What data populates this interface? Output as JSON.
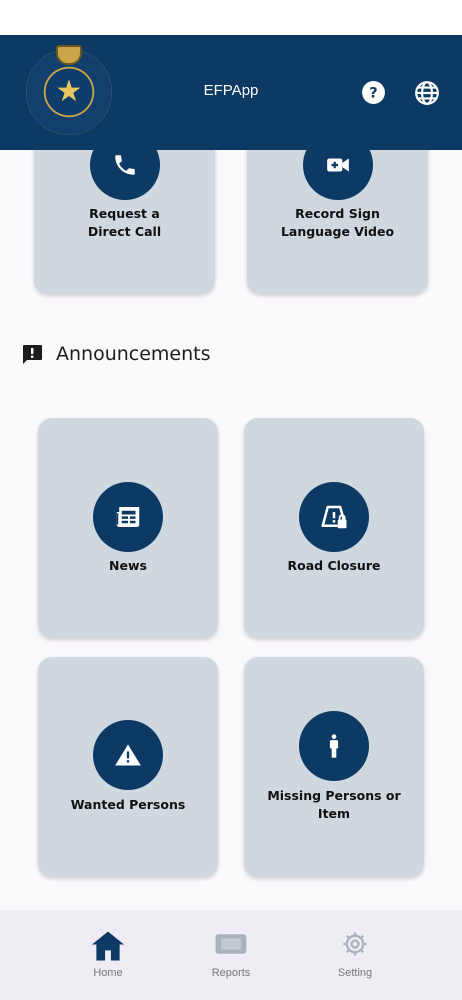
{
  "app": {
    "title": "EFPApp"
  },
  "colors": {
    "primary": "#0d3a64",
    "card": "#cfd8df",
    "background": "#fcf9fd",
    "nav_bg": "#efedf3",
    "inactive": "#a9b4bd"
  },
  "header": {
    "icons": [
      "help-icon",
      "globe-icon"
    ]
  },
  "top_cards": [
    {
      "label": "Request a\nDirect  Call",
      "icon": "phone-icon"
    },
    {
      "label": "Record Sign\nLanguage Video",
      "icon": "video-camera-icon"
    }
  ],
  "announcements": {
    "title": "Announcements",
    "icon": "announcement-icon",
    "cards": [
      {
        "label": "News",
        "icon": "newspaper-icon"
      },
      {
        "label": "Road Closure",
        "icon": "road-closure-icon"
      },
      {
        "label": "Wanted Persons",
        "icon": "warning-icon"
      },
      {
        "label": "Missing Persons or\nItem",
        "icon": "person-icon"
      }
    ]
  },
  "nav": {
    "items": [
      {
        "label": "Home",
        "icon": "home-icon",
        "active": true
      },
      {
        "label": "Reports",
        "icon": "reports-icon",
        "active": false
      },
      {
        "label": "Setting",
        "icon": "gear-icon",
        "active": false
      }
    ]
  }
}
